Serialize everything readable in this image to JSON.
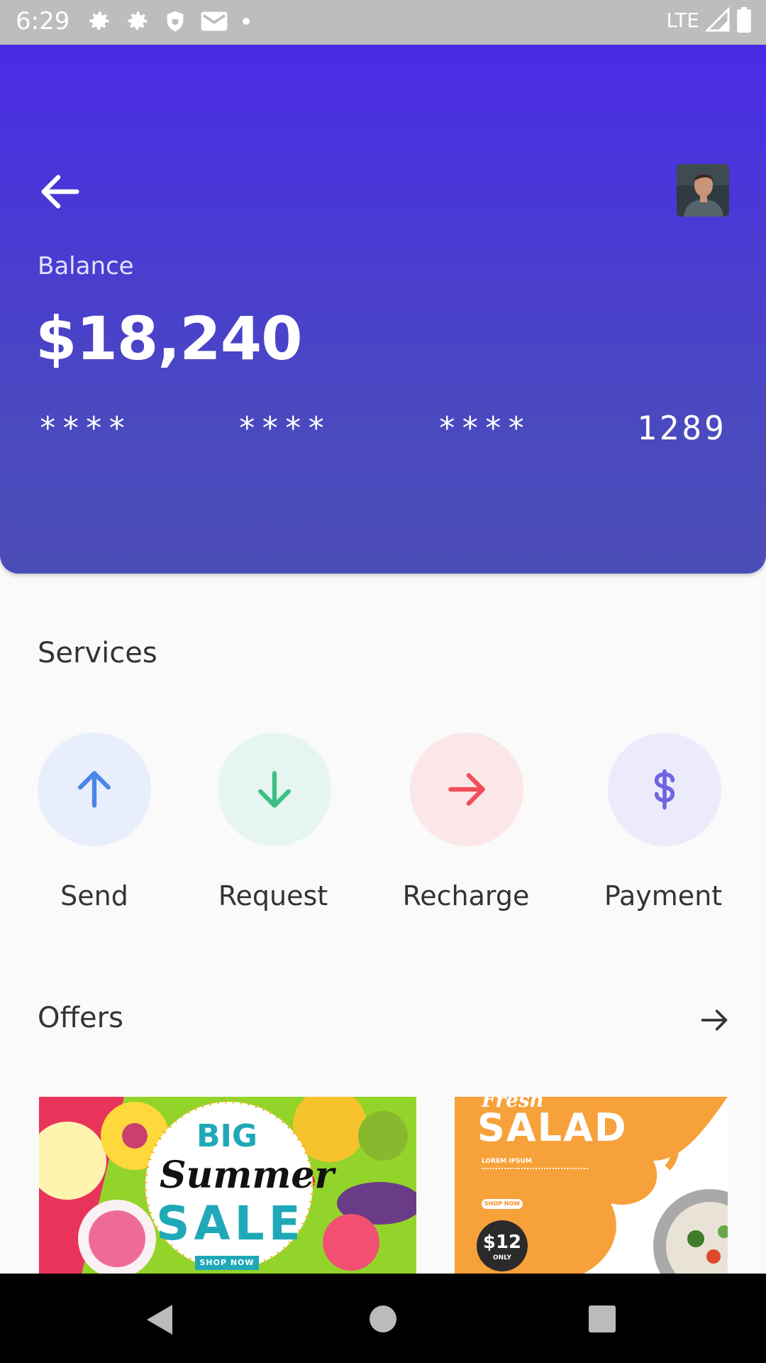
{
  "status_bar": {
    "time": "6:29",
    "network": "LTE",
    "icons": [
      "gear-icon",
      "gear-icon",
      "shield-icon",
      "gmail-icon",
      "dot-icon",
      "signal-icon",
      "battery-icon"
    ]
  },
  "header": {
    "balance_label": "Balance",
    "balance_amount": "$18,240",
    "card_number": {
      "group1": "****",
      "group2": "****",
      "group3": "****",
      "last4": "1289"
    },
    "colors": {
      "gradient_top": "#4a2be6",
      "gradient_bottom": "#4b4db6"
    }
  },
  "services": {
    "title": "Services",
    "items": [
      {
        "label": "Send",
        "icon": "arrow-up-icon",
        "color": "#4a86e8",
        "bg": "#e8eefb"
      },
      {
        "label": "Request",
        "icon": "arrow-down-icon",
        "color": "#3cbf83",
        "bg": "#e6f5ef"
      },
      {
        "label": "Recharge",
        "icon": "arrow-right-icon",
        "color": "#f04e5a",
        "bg": "#fbe6e8"
      },
      {
        "label": "Payment",
        "icon": "dollar-icon",
        "color": "#6f64e0",
        "bg": "#ebebfb"
      }
    ]
  },
  "offers": {
    "title": "Offers",
    "cards": [
      {
        "line1": "BIG",
        "line2": "Summer",
        "line3": "SALE",
        "cta": "SHOP NOW"
      },
      {
        "line1": "Fresh",
        "line2": "SALAD",
        "subtitle": "LOREM IPSUM",
        "cta": "SHOP NOW",
        "price": "$12",
        "price_note": "ONLY"
      }
    ]
  }
}
